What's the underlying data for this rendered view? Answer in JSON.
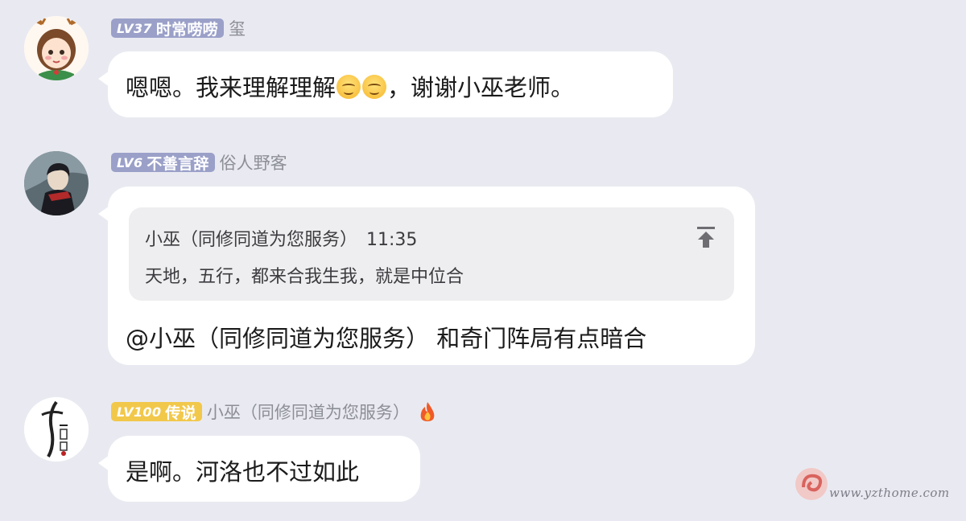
{
  "messages": [
    {
      "level": "LV37",
      "title": "时常唠唠",
      "nickname": "玺",
      "badge_color": "#9aa0c8",
      "text_before": "嗯嗯。我来理解理解",
      "emojis": [
        "smiling-face-icon",
        "smiling-face-icon"
      ],
      "text_after": "，谢谢小巫老师。"
    },
    {
      "level": "LV6",
      "title": "不善言辞",
      "nickname": "俗人野客",
      "badge_color": "#9aa0c8",
      "quote": {
        "author": "小巫（同修同道为您服务）",
        "time": "11:35",
        "text": "天地，五行，都来合我生我，就是中位合",
        "icon": "jump-to-top-icon"
      },
      "text": "@小巫（同修同道为您服务） 和奇门阵局有点暗合"
    },
    {
      "level": "LV100",
      "title": "传说",
      "nickname": "小巫（同修同道为您服务）",
      "badge_color": "#f2c84b",
      "nickname_icon": "fire-icon",
      "text": "是啊。河洛也不过如此"
    }
  ],
  "watermark": {
    "text": "www.yzthome.com"
  }
}
